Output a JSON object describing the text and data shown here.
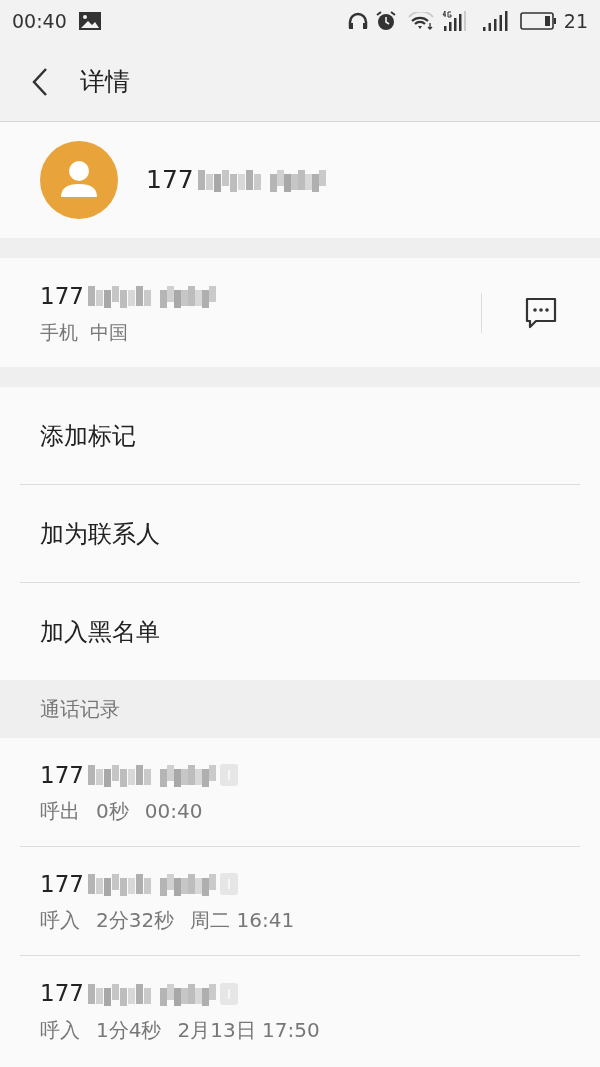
{
  "status_bar": {
    "time": "00:40",
    "battery": "21"
  },
  "header": {
    "title": "详情"
  },
  "contact": {
    "number_prefix": "177"
  },
  "number_card": {
    "number_prefix": "177",
    "type": "手机",
    "region": "中国"
  },
  "actions": [
    {
      "label": "添加标记"
    },
    {
      "label": "加为联系人"
    },
    {
      "label": "加入黑名单"
    }
  ],
  "call_log": {
    "title": "通话记录",
    "entries": [
      {
        "number_prefix": "177",
        "direction": "呼出",
        "duration": "0秒",
        "time": "00:40"
      },
      {
        "number_prefix": "177",
        "direction": "呼入",
        "duration": "2分32秒",
        "time": "周二 16:41"
      },
      {
        "number_prefix": "177",
        "direction": "呼入",
        "duration": "1分4秒",
        "time": "2月13日 17:50"
      }
    ]
  }
}
